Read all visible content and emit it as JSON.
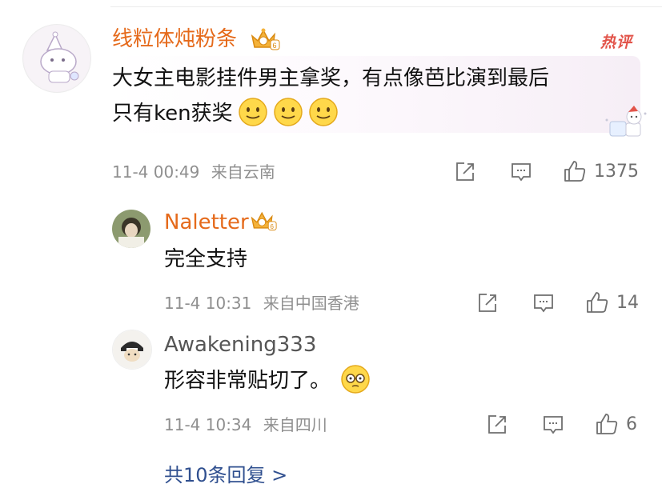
{
  "main_comment": {
    "username": "线粒体炖粉条",
    "hot_badge": "热评",
    "text_line1": "大女主电影挂件男主拿奖，有点像芭比演到最后",
    "text_line2": "只有ken获奖",
    "emoji_count": 3,
    "time": "11-4 00:49",
    "location": "来自云南",
    "likes": "1375"
  },
  "replies": [
    {
      "username": "Naletter",
      "text": "完全支持",
      "time": "11-4 10:31",
      "location": "来自中国香港",
      "likes": "14"
    },
    {
      "username": "Awakening333",
      "text": "形容非常贴切了。",
      "time": "11-4 10:34",
      "location": "来自四川",
      "likes": "6"
    }
  ],
  "more_replies": "共10条回复 >",
  "colors": {
    "username": "#e56a1b",
    "hot": "#e2544a",
    "link": "#2f4f8f",
    "meta": "#8f8f8f"
  },
  "icons": [
    "crown-vip-icon",
    "share-icon",
    "comment-icon",
    "like-icon",
    "smile-emoji-icon",
    "glasses-emoji-icon"
  ]
}
